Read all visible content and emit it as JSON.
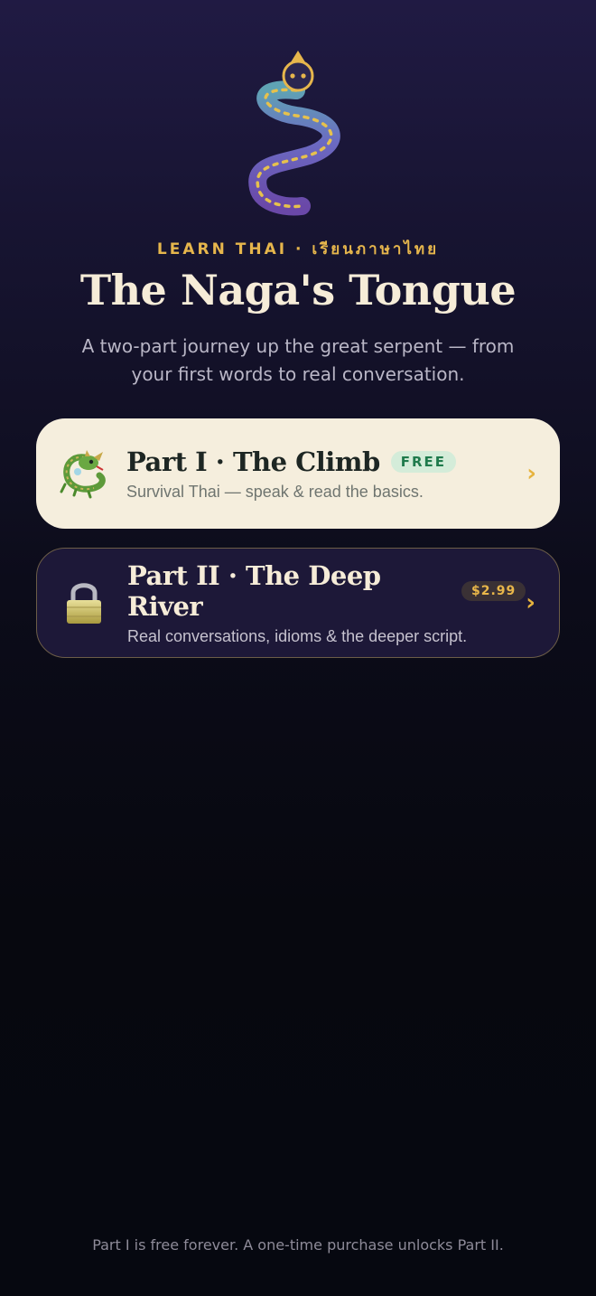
{
  "header": {
    "logo_icon": "serpent-logo-icon",
    "kicker": "LEARN THAI · เรียนภาษาไทย",
    "title": "The Naga's Tongue",
    "subtitle": "A two-part journey up the great serpent — from your first words to real conversation."
  },
  "parts": [
    {
      "icon": "dragon-icon",
      "title": "Part I · The Climb",
      "badge": "FREE",
      "description": "Survival Thai — speak & read the basics.",
      "chevron": "›"
    },
    {
      "icon": "lock-icon",
      "title": "Part II · The Deep River",
      "badge": "$2.99",
      "description": "Real conversations, idioms & the deeper script.",
      "chevron": "›"
    }
  ],
  "footer": "Part I is free forever. A one-time purchase unlocks Part II.",
  "colors": {
    "accent": "#e6b64c",
    "free_badge": "#1f7a4c",
    "card_light": "#f5eedd",
    "card_dark": "#1d1838"
  }
}
